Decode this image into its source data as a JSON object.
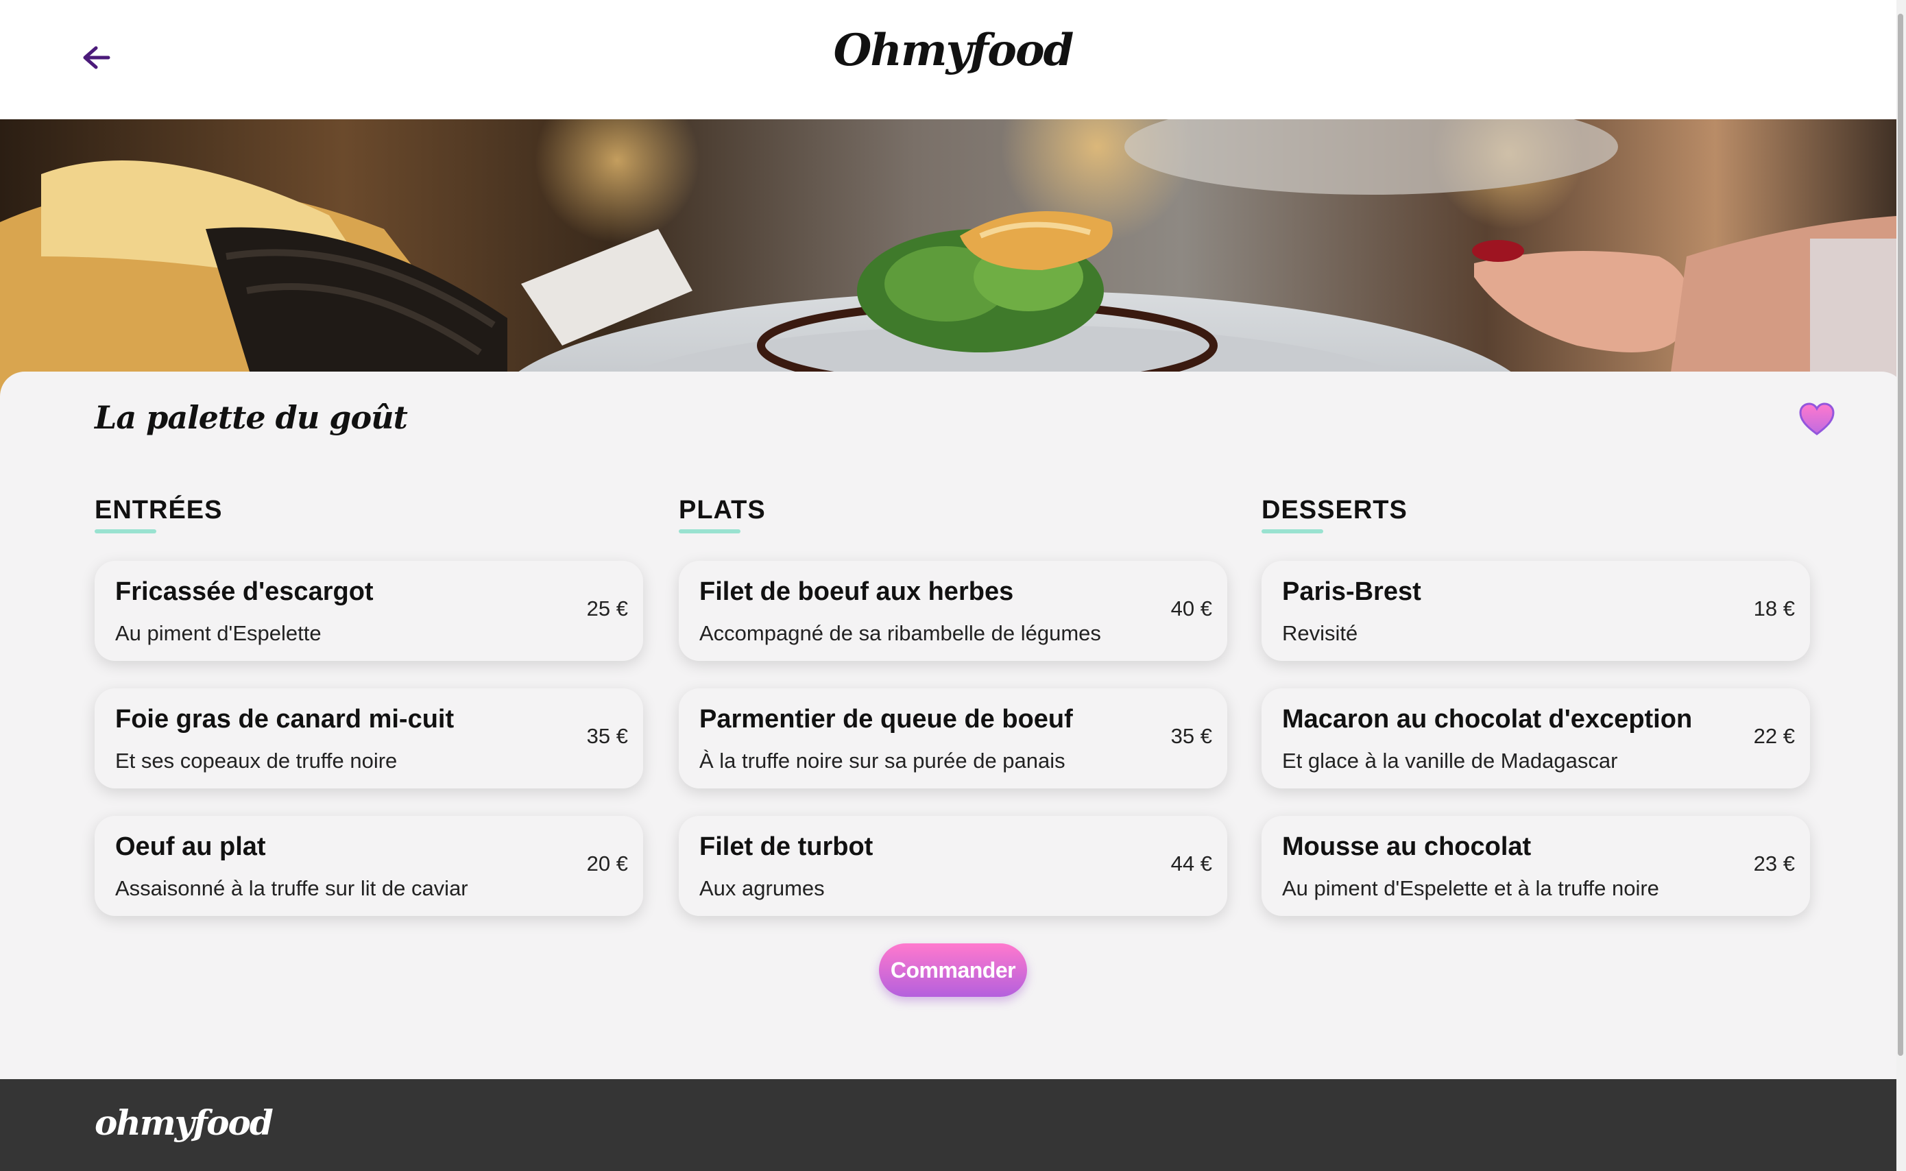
{
  "header": {
    "logo": "Ohmyfood",
    "back_icon": "arrow-left-icon"
  },
  "hero": {
    "image": "restaurant plated dish photo"
  },
  "restaurant": {
    "name": "La palette du goût",
    "favorite_icon": "heart-icon"
  },
  "menu": {
    "sections": [
      {
        "title": "ENTRÉES",
        "dishes": [
          {
            "name": "Fricassée d'escargot",
            "description": "Au piment d'Espelette",
            "price": "25 €"
          },
          {
            "name": "Foie gras de canard mi-cuit",
            "description": "Et ses copeaux de truffe noire",
            "price": "35 €"
          },
          {
            "name": "Oeuf au plat",
            "description": "Assaisonné à la truffe sur lit de caviar",
            "price": "20 €"
          }
        ]
      },
      {
        "title": "PLATS",
        "dishes": [
          {
            "name": "Filet de boeuf aux herbes",
            "description": "Accompagné de sa ribambelle de légumes",
            "price": "40 €"
          },
          {
            "name": "Parmentier de queue de boeuf",
            "description": "À la truffe noire sur sa purée de panais",
            "price": "35 €"
          },
          {
            "name": "Filet de turbot",
            "description": "Aux agrumes",
            "price": "44 €"
          }
        ]
      },
      {
        "title": "DESSERTS",
        "dishes": [
          {
            "name": "Paris-Brest",
            "description": "Revisité",
            "price": "18 €"
          },
          {
            "name": "Macaron au chocolat d'exception",
            "description": "Et glace à la vanille de Madagascar",
            "price": "22 €"
          },
          {
            "name": "Mousse au chocolat",
            "description": "Au piment d'Espelette et à la truffe noire",
            "price": "23 €"
          }
        ]
      }
    ]
  },
  "order_button": "Commander",
  "footer": {
    "logo": "ohmyfood"
  },
  "colors": {
    "accent_pink": "#ff79cd",
    "accent_purple": "#9356dc",
    "underline_mint": "#99e2d0",
    "footer_bg": "#353535"
  }
}
